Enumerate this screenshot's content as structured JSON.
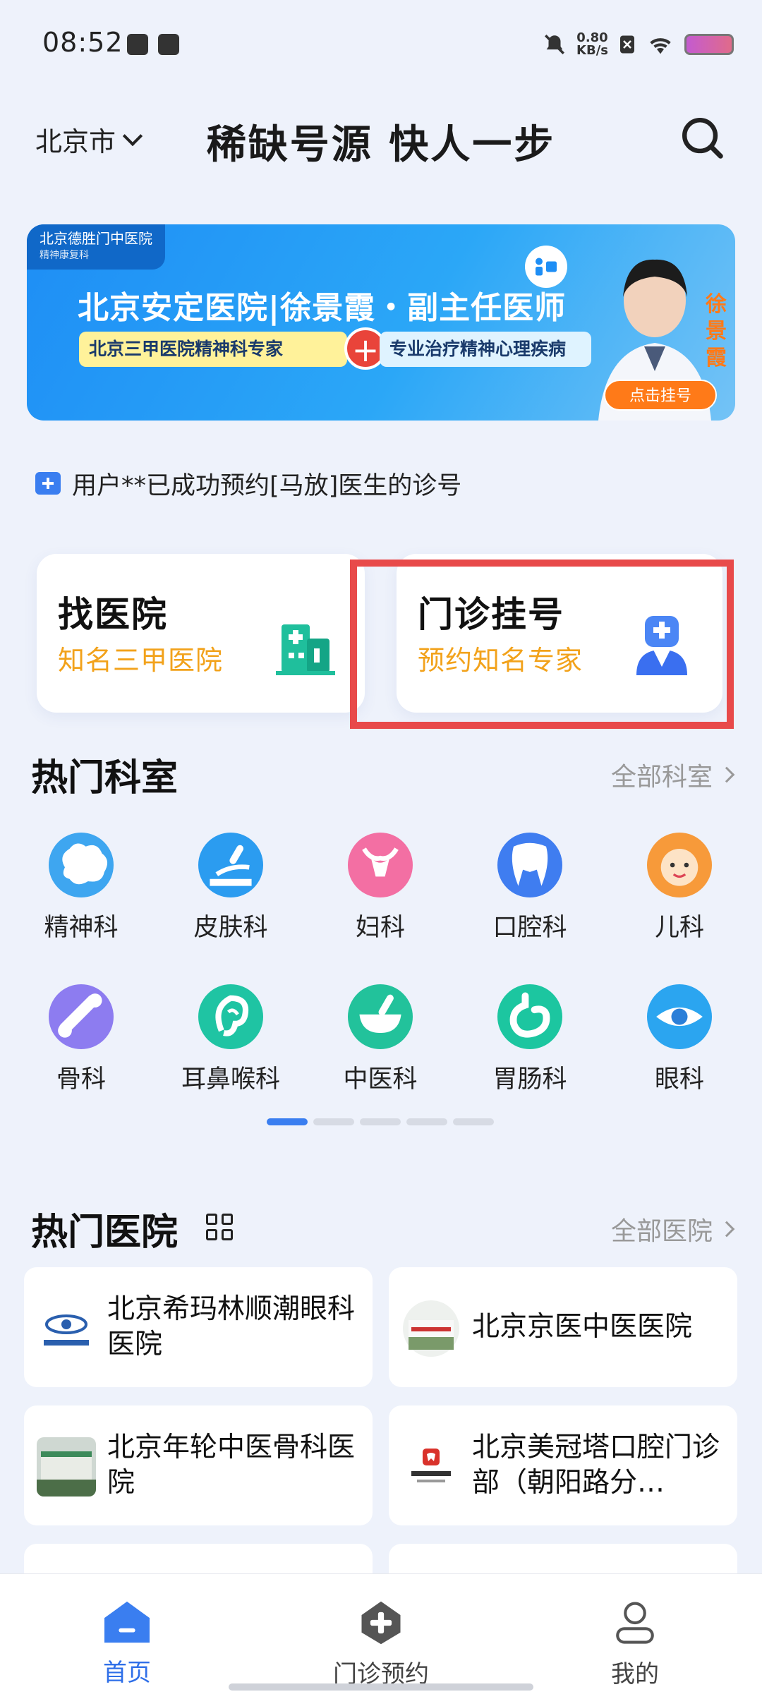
{
  "status_bar": {
    "time": "08:52",
    "net_speed_value": "0.80",
    "net_speed_unit": "KB/s"
  },
  "header": {
    "city": "北京市",
    "slogan": "稀缺号源 快人一步"
  },
  "banner": {
    "tag": "北京德胜门中医院",
    "tag_sub": "精神康复科",
    "title": "北京安定医院|徐景霞・副主任医师",
    "pill_left": "北京三甲医院精神科专家",
    "pill_right": "专业治疗精神心理疾病",
    "vertical_name": "徐景霞",
    "cta": "点击挂号"
  },
  "ticker": {
    "text": "用户**已成功预约[马放]医生的诊号"
  },
  "quick": {
    "find_hospital": {
      "title": "找医院",
      "subtitle": "知名三甲医院"
    },
    "outpatient": {
      "title": "门诊挂号",
      "subtitle": "预约知名专家"
    }
  },
  "departments": {
    "title": "热门科室",
    "more": "全部科室",
    "items": [
      {
        "label": "精神科",
        "icon": "brain-icon",
        "color": "#3ea6f0"
      },
      {
        "label": "皮肤科",
        "icon": "skin-care-icon",
        "color": "#2b9cf0"
      },
      {
        "label": "妇科",
        "icon": "uterus-icon",
        "color": "#f36fa3"
      },
      {
        "label": "口腔科",
        "icon": "tooth-icon",
        "color": "#3f7df0"
      },
      {
        "label": "儿科",
        "icon": "baby-face-icon",
        "color": "#f79a3a"
      },
      {
        "label": "骨科",
        "icon": "bone-icon",
        "color": "#8d7cf0"
      },
      {
        "label": "耳鼻喉科",
        "icon": "ear-icon",
        "color": "#1fc4a3"
      },
      {
        "label": "中医科",
        "icon": "mortar-icon",
        "color": "#22c29b"
      },
      {
        "label": "胃肠科",
        "icon": "stomach-icon",
        "color": "#1cc6a0"
      },
      {
        "label": "眼科",
        "icon": "eye-icon",
        "color": "#2ba5f0"
      }
    ],
    "page_count": 5,
    "active_page": 1
  },
  "hospitals": {
    "title": "热门医院",
    "more": "全部医院",
    "items": [
      {
        "name": "北京希玛林顺潮眼科医院"
      },
      {
        "name": "北京京医中医医院"
      },
      {
        "name": "北京年轮中医骨科医院"
      },
      {
        "name": "北京美冠塔口腔门诊部（朝阳路分…"
      }
    ]
  },
  "bottom_nav": {
    "items": [
      {
        "label": "首页",
        "icon": "home-icon",
        "active": true
      },
      {
        "label": "门诊预约",
        "icon": "medical-cross-icon",
        "active": false
      },
      {
        "label": "我的",
        "icon": "user-icon",
        "active": false
      }
    ]
  },
  "colors": {
    "accent": "#3a7ef0",
    "subtitle_orange": "#f2a21b",
    "highlight_red": "#e84a4a"
  }
}
